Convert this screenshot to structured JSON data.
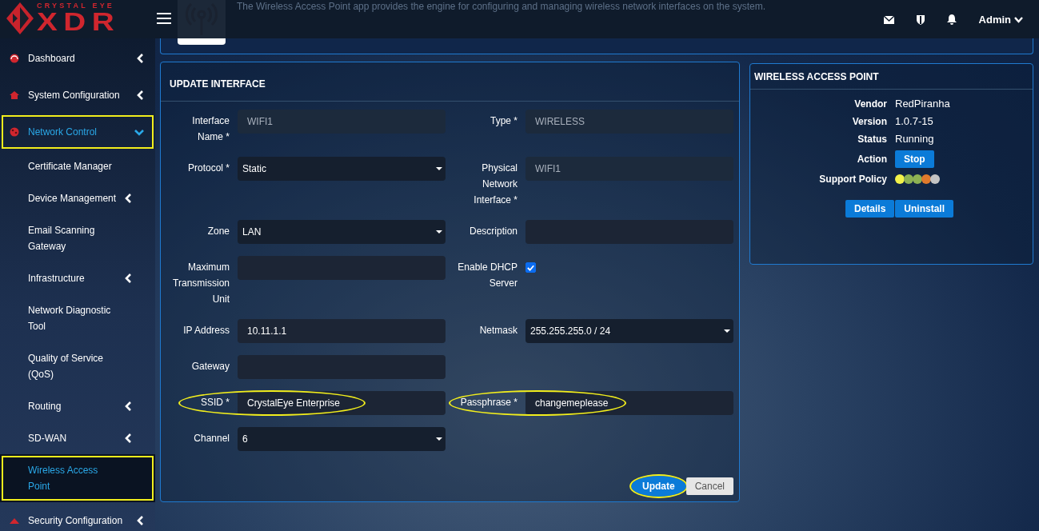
{
  "header": {
    "logo_top": "CRYSTAL EYE",
    "logo_main": "XDR",
    "description": "The Wireless Access Point app provides the engine for configuring and managing wireless network interfaces on the system.",
    "user": "Admin"
  },
  "sidebar": {
    "items": [
      {
        "label": "Dashboard",
        "expanded": false,
        "selected": false,
        "highlighted": false
      },
      {
        "label": "System Configuration",
        "expanded": false,
        "selected": false,
        "highlighted": false
      },
      {
        "label": "Network Control",
        "expanded": true,
        "selected": false,
        "highlighted": true,
        "children": [
          {
            "label": "Certificate Manager",
            "selected": false,
            "highlighted": false
          },
          {
            "label": "Device Management",
            "expanded": false,
            "selected": false,
            "highlighted": false
          },
          {
            "label": "Email Scanning Gateway",
            "selected": false,
            "highlighted": false
          },
          {
            "label": "Infrastructure",
            "expanded": false,
            "selected": false,
            "highlighted": false
          },
          {
            "label": "Network Diagnostic Tool",
            "selected": false,
            "highlighted": false
          },
          {
            "label": "Quality of Service (QoS)",
            "selected": false,
            "highlighted": false
          },
          {
            "label": "Routing",
            "expanded": false,
            "selected": false,
            "highlighted": false
          },
          {
            "label": "SD-WAN",
            "expanded": false,
            "selected": false,
            "highlighted": false
          },
          {
            "label": "Wireless Access Point",
            "selected": true,
            "highlighted": true
          }
        ]
      },
      {
        "label": "Security Configuration",
        "expanded": false,
        "selected": false,
        "highlighted": false
      }
    ]
  },
  "form": {
    "title": "UPDATE INTERFACE",
    "rows": [
      [
        {
          "label": "Interface Name *",
          "kind": "text",
          "value": "WIFI1",
          "disabled": true,
          "highlighted": false
        },
        {
          "label": "Type *",
          "kind": "text",
          "value": "WIRELESS",
          "disabled": true,
          "highlighted": false
        }
      ],
      [
        {
          "label": "Protocol *",
          "kind": "select",
          "value": "Static",
          "disabled": false,
          "highlighted": false
        },
        {
          "label": "Physical Network Interface *",
          "kind": "text",
          "value": "WIFI1",
          "disabled": true,
          "highlighted": false
        }
      ],
      [
        {
          "label": "Zone",
          "kind": "select",
          "value": "LAN",
          "disabled": false,
          "highlighted": false
        },
        {
          "label": "Description",
          "kind": "text",
          "disabled": false,
          "highlighted": false
        }
      ],
      [
        {
          "label": "Maximum Transmission Unit",
          "kind": "text",
          "disabled": false,
          "highlighted": false
        },
        {
          "label": "Enable DHCP Server",
          "kind": "checkbox",
          "checked": true,
          "highlighted": false
        }
      ],
      [
        {
          "label": "IP Address",
          "kind": "text",
          "value": "10.11.1.1",
          "disabled": false,
          "highlighted": false
        },
        {
          "label": "Netmask",
          "kind": "select",
          "value": "255.255.255.0 / 24",
          "disabled": false,
          "highlighted": false
        }
      ],
      [
        {
          "label": "Gateway",
          "kind": "text",
          "disabled": false,
          "highlighted": false
        }
      ],
      [
        {
          "label": "SSID *",
          "kind": "text",
          "value": "CrystalEye Enterprise",
          "disabled": false,
          "highlighted": true
        },
        {
          "label": "Passphrase *",
          "kind": "text",
          "value": "changemeplease",
          "disabled": false,
          "highlighted": true
        }
      ],
      [
        {
          "label": "Channel",
          "kind": "select",
          "value": "6",
          "disabled": false,
          "highlighted": false
        }
      ]
    ],
    "buttons": [
      {
        "label": "Update",
        "kind": "primary",
        "highlighted": true
      },
      {
        "label": "Cancel",
        "kind": "secondary",
        "highlighted": false
      }
    ]
  },
  "app_panel": {
    "title": "WIRELESS ACCESS POINT",
    "info": [
      {
        "label": "Vendor",
        "kind": "text",
        "value": "RedPiranha"
      },
      {
        "label": "Version",
        "kind": "text",
        "value": "1.0.7-15"
      },
      {
        "label": "Status",
        "kind": "text",
        "value": "Running"
      },
      {
        "label": "Action",
        "kind": "button",
        "value": "Stop"
      },
      {
        "label": "Support Policy",
        "kind": "dots",
        "dots": [
          {
            "color": "#f2f24a"
          },
          {
            "color": "#8db153"
          },
          {
            "color": "#8db153"
          },
          {
            "color": "#e07a2c"
          },
          {
            "color": "#c4c4c4"
          }
        ]
      }
    ],
    "buttons": [
      "Details",
      "Uninstall"
    ]
  }
}
